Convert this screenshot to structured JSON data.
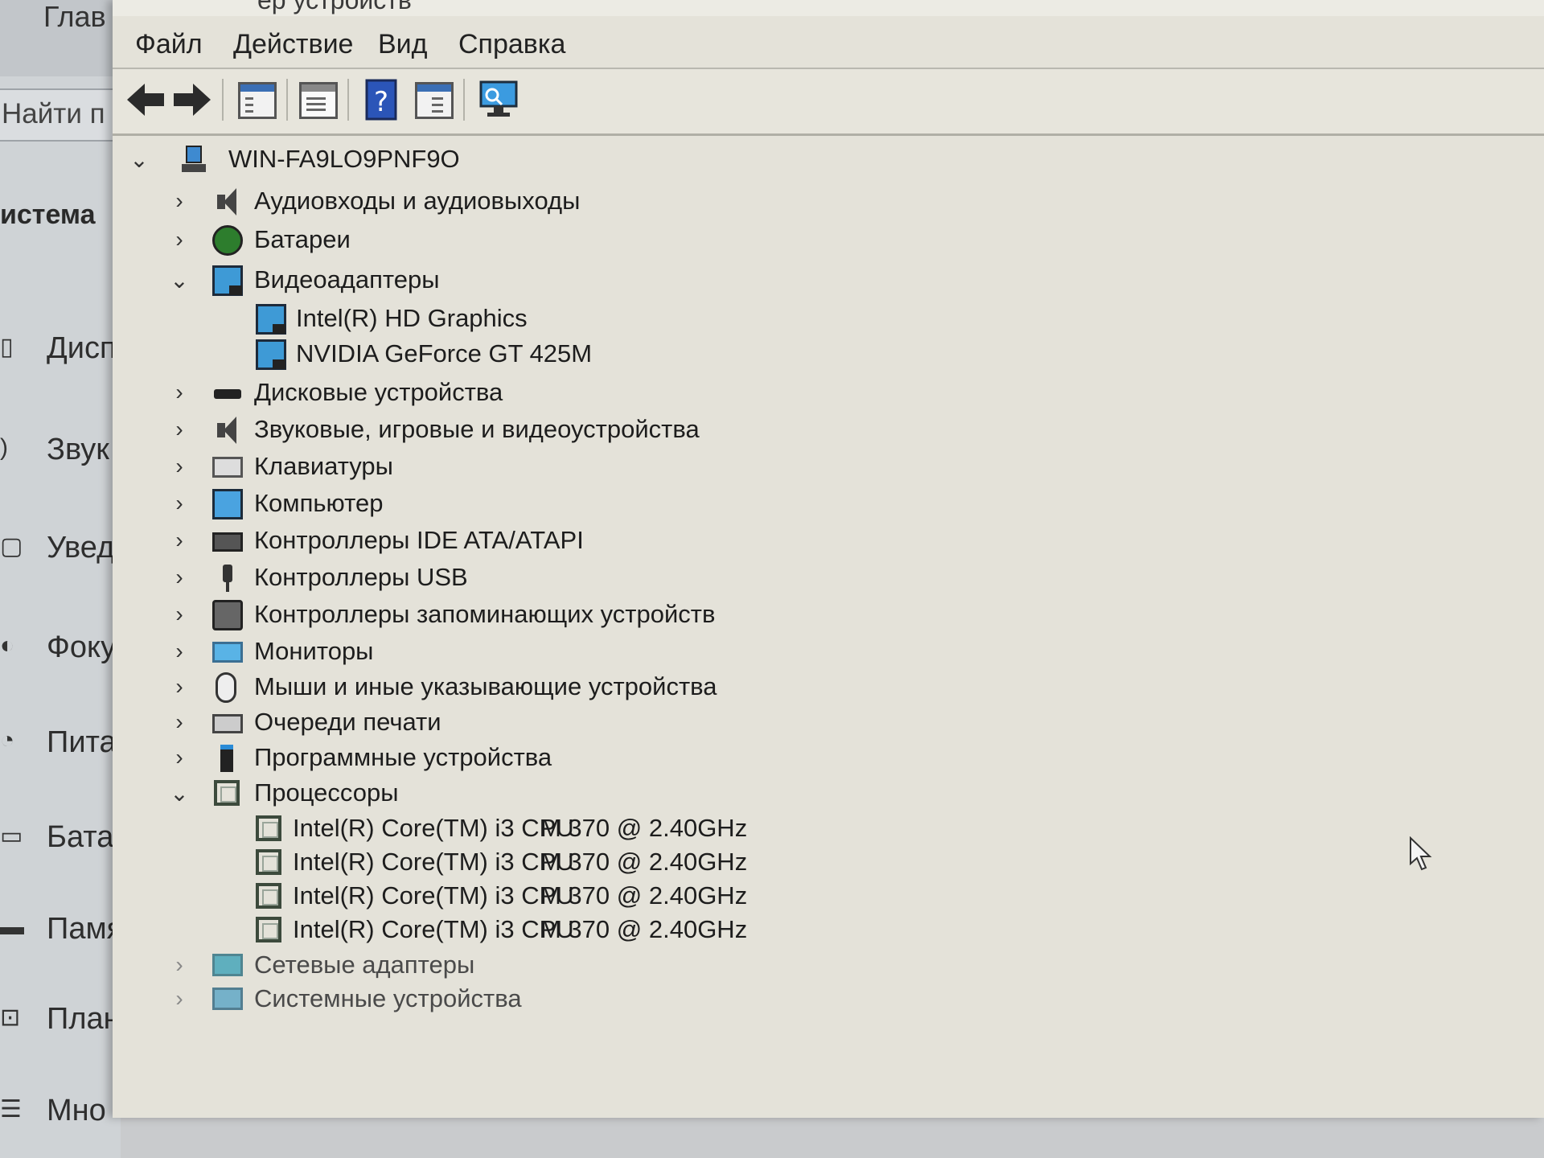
{
  "settings": {
    "home_partial": "Глав",
    "search_partial": "Найти п",
    "system_partial": "истема",
    "nav": [
      {
        "label": "Дисп",
        "icon": "display-icon"
      },
      {
        "label": "Звук",
        "icon": "sound-icon"
      },
      {
        "label": "Увед",
        "icon": "notifications-icon"
      },
      {
        "label": "Фоку",
        "icon": "focus-icon"
      },
      {
        "label": "Пита",
        "icon": "power-icon"
      },
      {
        "label": "Батар",
        "icon": "battery-icon"
      },
      {
        "label": "Памя",
        "icon": "storage-icon"
      },
      {
        "label": "План",
        "icon": "tablet-icon"
      },
      {
        "label": "Мно",
        "icon": "multitasking-icon"
      }
    ]
  },
  "window": {
    "title_partial": "ер устройств"
  },
  "menu": {
    "file": "Файл",
    "action": "Действие",
    "view": "Вид",
    "help": "Справка"
  },
  "toolbar": {
    "buttons": [
      "back-icon",
      "forward-icon",
      "show-hide-tree-icon",
      "properties-icon",
      "help-icon",
      "action-pane-icon",
      "scan-hardware-icon"
    ]
  },
  "tree": {
    "root": "WIN-FA9LO9PNF9O",
    "categories": [
      {
        "label": "Аудиовходы и аудиовыходы",
        "expanded": false
      },
      {
        "label": "Батареи",
        "expanded": false
      },
      {
        "label": "Видеоадаптеры",
        "expanded": true,
        "children": [
          "Intel(R) HD Graphics",
          "NVIDIA GeForce GT 425M"
        ]
      },
      {
        "label": "Дисковые устройства",
        "expanded": false
      },
      {
        "label": "Звуковые, игровые и видеоустройства",
        "expanded": false
      },
      {
        "label": "Клавиатуры",
        "expanded": false
      },
      {
        "label": "Компьютер",
        "expanded": false
      },
      {
        "label": "Контроллеры IDE ATA/ATAPI",
        "expanded": false
      },
      {
        "label": "Контроллеры USB",
        "expanded": false
      },
      {
        "label": "Контроллеры запоминающих устройств",
        "expanded": false
      },
      {
        "label": "Мониторы",
        "expanded": false
      },
      {
        "label": "Мыши и иные указывающие устройства",
        "expanded": false
      },
      {
        "label": "Очереди печати",
        "expanded": false
      },
      {
        "label": "Программные устройства",
        "expanded": false
      },
      {
        "label": "Процессоры",
        "expanded": true,
        "children": [
          {
            "name": "Intel(R) Core(TM) i3 CPU",
            "model": "M 370  @ 2.40GHz"
          },
          {
            "name": "Intel(R) Core(TM) i3 CPU",
            "model": "M 370  @ 2.40GHz"
          },
          {
            "name": "Intel(R) Core(TM) i3 CPU",
            "model": "M 370  @ 2.40GHz"
          },
          {
            "name": "Intel(R) Core(TM) i3 CPU",
            "model": "M 370  @ 2.40GHz"
          }
        ]
      },
      {
        "label": "Сетевые адаптеры",
        "expanded": false
      },
      {
        "label": "Системные устройства",
        "expanded": false
      }
    ]
  }
}
